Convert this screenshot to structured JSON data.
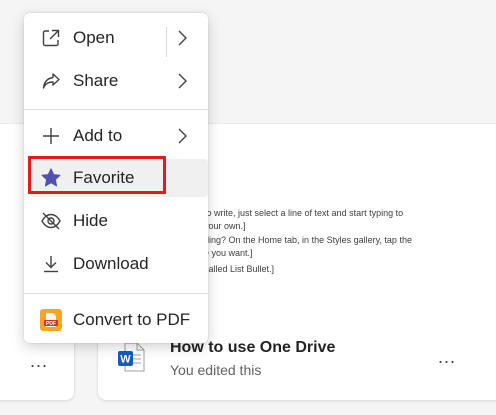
{
  "menu": {
    "items": [
      {
        "id": "open",
        "label": "Open",
        "icon": "open-in-new-icon",
        "submenu": true
      },
      {
        "id": "share",
        "label": "Share",
        "icon": "share-icon",
        "submenu": true
      },
      {
        "id": "add_to",
        "label": "Add to",
        "icon": "plus-icon",
        "submenu": true
      },
      {
        "id": "favorite",
        "label": "Favorite",
        "icon": "star-filled-icon",
        "submenu": false,
        "highlighted": true
      },
      {
        "id": "hide",
        "label": "Hide",
        "icon": "eye-off-icon",
        "submenu": false
      },
      {
        "id": "download",
        "label": "Download",
        "icon": "download-icon",
        "submenu": false
      },
      {
        "id": "convert_pdf",
        "label": "Convert to PDF",
        "icon": "pdf-icon",
        "submenu": false
      }
    ]
  },
  "file_card": {
    "title": "How to use One Drive",
    "subtitle": "You edited this",
    "more_label": "...",
    "preview_lines": [
      "to write, just select a line of text and start typing to",
      "your own.]",
      "ding? On the Home tab, in the Styles gallery, tap the",
      "e you want.]",
      "called List Bullet.]"
    ]
  },
  "left_card": {
    "more_label": "..."
  },
  "colors": {
    "accent_star": "#4f52b2",
    "highlight_border": "#e41b1b",
    "pdf_icon_bg": "#f5a623",
    "word_blue": "#185abd"
  }
}
